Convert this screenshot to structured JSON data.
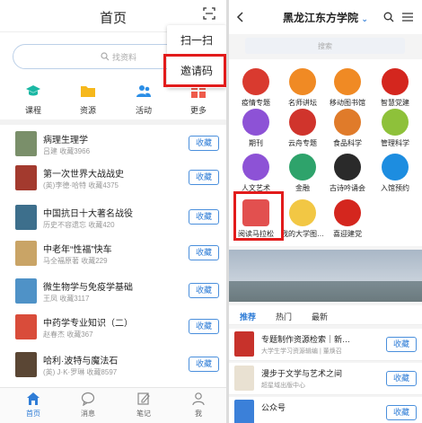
{
  "left": {
    "title": "首页",
    "search_placeholder": "找资料",
    "popup": {
      "scan": "扫一扫",
      "invite": "邀请码"
    },
    "quick": [
      {
        "label": "课程",
        "icon": "graduation-cap-icon",
        "color": "#1bb8a4"
      },
      {
        "label": "资源",
        "icon": "folder-icon",
        "color": "#f6b81c"
      },
      {
        "label": "活动",
        "icon": "people-icon",
        "color": "#2b8ee6"
      },
      {
        "label": "更多",
        "icon": "grid-icon",
        "color": "#ef5b4b"
      }
    ],
    "fav_label": "收藏",
    "books": [
      {
        "title": "病理生理学",
        "meta": "吕建 收藏3966",
        "color": "#7a8f6a"
      },
      {
        "title": "第一次世界大战战史",
        "meta": "(英)李德·哈特 收藏4375",
        "color": "#a33a2e"
      },
      {
        "title": "中国抗日十大著名战役",
        "meta": "历史不容遗忘 收藏420",
        "color": "#3d6f8c"
      },
      {
        "title": "中老年“性福”快车",
        "meta": "马全福原著 收藏229",
        "color": "#c9a466"
      },
      {
        "title": "微生物学与免疫学基础",
        "meta": "王凤 收藏3117",
        "color": "#4f92c7"
      },
      {
        "title": "中药学专业知识（二）",
        "meta": "赵春杰 收藏367",
        "color": "#d94c3a"
      },
      {
        "title": "哈利·波特与魔法石",
        "meta": "(英) J·K·罗琳 收藏8597",
        "color": "#5a4634"
      }
    ],
    "tabs": [
      {
        "label": "首页",
        "icon": "home-icon",
        "active": true
      },
      {
        "label": "消息",
        "icon": "message-icon",
        "active": false
      },
      {
        "label": "笔记",
        "icon": "note-icon",
        "active": false
      },
      {
        "label": "我",
        "icon": "user-icon",
        "active": false
      }
    ]
  },
  "right": {
    "title": "黑龙江东方学院",
    "search_placeholder": "搜索",
    "apps": [
      {
        "label": "疫情专题",
        "color": "#d93a2f"
      },
      {
        "label": "名师讲坛",
        "color": "#f08a24"
      },
      {
        "label": "移动图书馆",
        "color": "#f08a24"
      },
      {
        "label": "智慧党建",
        "color": "#d4261e"
      },
      {
        "label": "期刊",
        "color": "#8d52d6"
      },
      {
        "label": "云舟专题",
        "color": "#d0342c"
      },
      {
        "label": "食品科学",
        "color": "#e07b2a"
      },
      {
        "label": "管理科学",
        "color": "#8ec13a"
      },
      {
        "label": "人文艺术",
        "color": "#8d52d6"
      },
      {
        "label": "金融",
        "color": "#2ea36b"
      },
      {
        "label": "古诗吟诵会",
        "color": "#2a2a2a"
      },
      {
        "label": "入馆预约",
        "color": "#1d8de0"
      },
      {
        "label": "阅读马拉松",
        "color": "#e2504f"
      },
      {
        "label": "我的大学图…",
        "color": "#f2c744"
      },
      {
        "label": "喜迎建党",
        "color": "#d4261e"
      }
    ],
    "tabs": [
      "推荐",
      "热门",
      "最新"
    ],
    "fav_label": "收藏",
    "items": [
      {
        "title": "专题制作资源检索｜新…",
        "meta": "大学生学习资源辑编 | 董焕召",
        "color": "#c7322b"
      },
      {
        "title": "漫步于文学与艺术之间",
        "meta": "超星域出版中心",
        "color": "#e9e1d2"
      },
      {
        "title": "公众号",
        "meta": "",
        "color": "#3b80d9"
      }
    ]
  }
}
